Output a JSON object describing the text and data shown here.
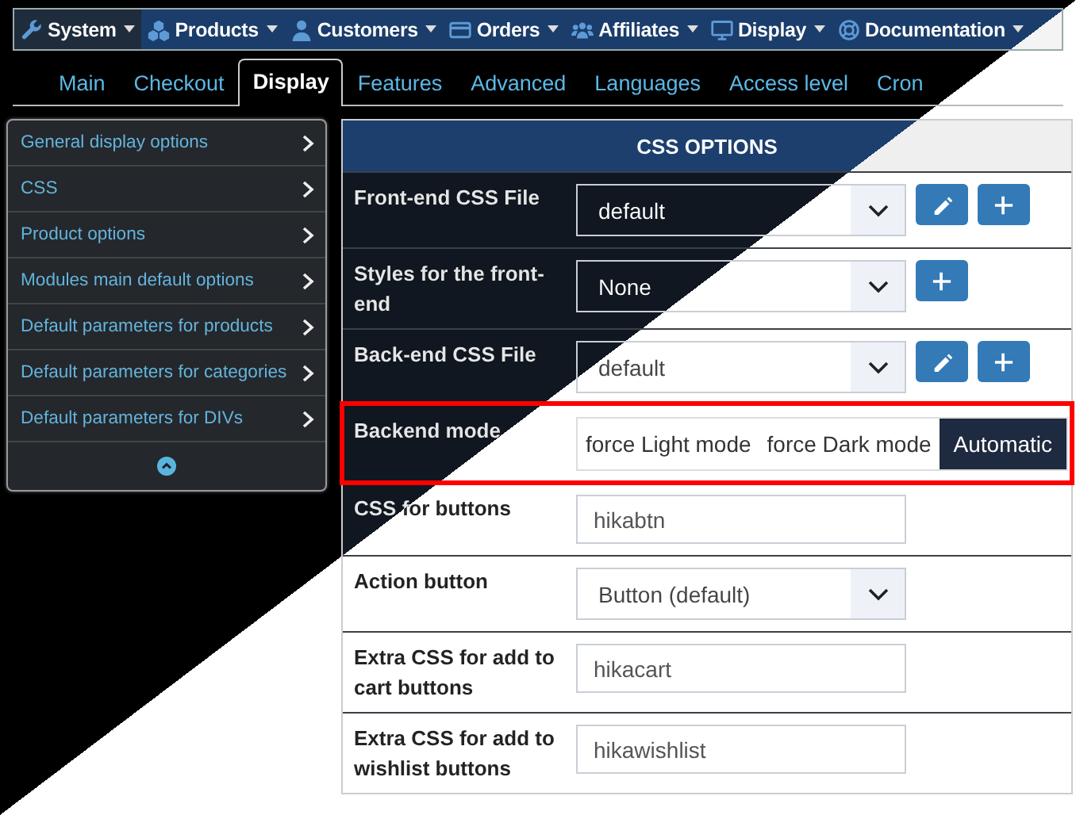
{
  "menu": [
    {
      "label": "System",
      "kind": "wrench",
      "selected": true
    },
    {
      "label": "Products",
      "kind": "cubes",
      "selected": false
    },
    {
      "label": "Customers",
      "kind": "person",
      "selected": false
    },
    {
      "label": "Orders",
      "kind": "card",
      "selected": false
    },
    {
      "label": "Affiliates",
      "kind": "group",
      "selected": false
    },
    {
      "label": "Display",
      "kind": "monitor",
      "selected": false
    },
    {
      "label": "Documentation",
      "kind": "lifebuoy",
      "selected": false
    }
  ],
  "tabs": [
    {
      "label": "Main",
      "selected": false
    },
    {
      "label": "Checkout",
      "selected": false
    },
    {
      "label": "Display",
      "selected": true
    },
    {
      "label": "Features",
      "selected": false
    },
    {
      "label": "Advanced",
      "selected": false
    },
    {
      "label": "Languages",
      "selected": false
    },
    {
      "label": "Access level",
      "selected": false
    },
    {
      "label": "Cron",
      "selected": false
    }
  ],
  "sidebar": {
    "items": [
      {
        "label": "General display options"
      },
      {
        "label": "CSS"
      },
      {
        "label": "Product options"
      },
      {
        "label": "Modules main default options"
      },
      {
        "label": "Default parameters for products"
      },
      {
        "label": "Default parameters for categories"
      },
      {
        "label": "Default parameters for DIVs"
      }
    ]
  },
  "panel": {
    "title": "CSS OPTIONS",
    "rows": [
      {
        "kind": "select",
        "label": "Front-end CSS File",
        "value": "default",
        "actions": [
          {
            "kind": "edit"
          },
          {
            "kind": "add"
          }
        ],
        "highlighted": false
      },
      {
        "kind": "select",
        "label": "Styles for the front-end",
        "value": "None",
        "actions": [
          {
            "kind": "add"
          }
        ],
        "highlighted": false
      },
      {
        "kind": "select",
        "label": "Back-end CSS File",
        "value": "default",
        "actions": [
          {
            "kind": "edit"
          },
          {
            "kind": "add"
          }
        ],
        "highlighted": false
      },
      {
        "kind": "segmented",
        "label": "Backend mode",
        "highlighted": true,
        "options": [
          {
            "label": "force Light mode",
            "selected": false
          },
          {
            "label": "force Dark mode",
            "selected": false
          },
          {
            "label": "Automatic",
            "selected": true
          }
        ]
      },
      {
        "kind": "text",
        "label": "CSS for buttons",
        "value": "hikabtn",
        "highlighted": false
      },
      {
        "kind": "select",
        "label": "Action button",
        "value": "Button (default)",
        "highlighted": false
      },
      {
        "kind": "text",
        "label": "Extra CSS for add to cart buttons",
        "value": "hikacart",
        "highlighted": false
      },
      {
        "kind": "text",
        "label": "Extra CSS for add to wishlist buttons",
        "value": "hikawishlist",
        "highlighted": false
      }
    ]
  }
}
